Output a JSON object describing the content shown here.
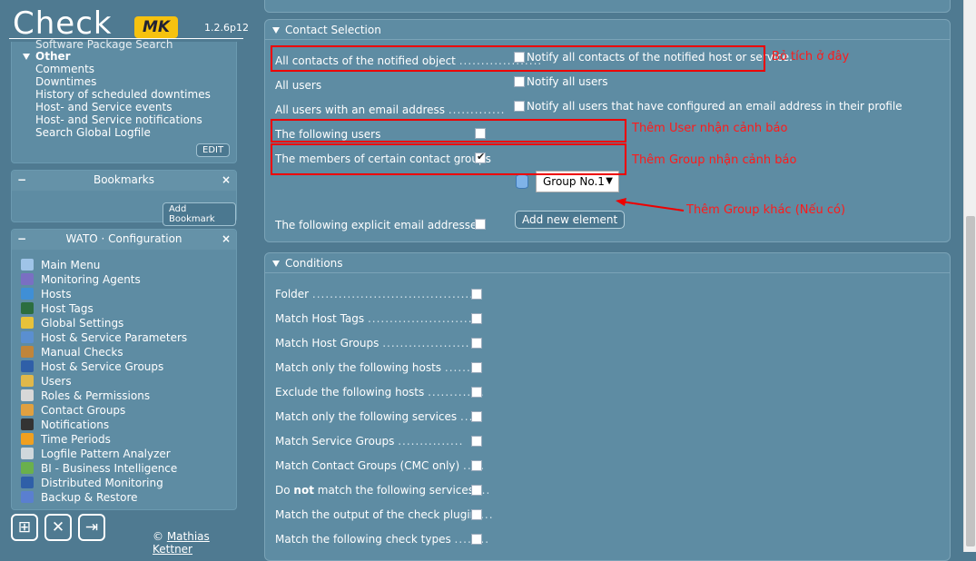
{
  "logo": {
    "text": "Check",
    "mk": "MK",
    "version": "1.2.6p12"
  },
  "views": {
    "cut_item": "Software Package Search",
    "group": "Other",
    "items": [
      "Comments",
      "Downtimes",
      "History of scheduled downtimes",
      "Host- and Service events",
      "Host- and Service notifications",
      "Search Global Logfile"
    ],
    "edit_label": "EDIT"
  },
  "bookmarks": {
    "title": "Bookmarks",
    "add_label": "Add Bookmark"
  },
  "wato": {
    "title": "WATO · Configuration",
    "items": [
      {
        "label": "Main Menu",
        "icon": "home-icon",
        "color": "#9fc4e8"
      },
      {
        "label": "Monitoring Agents",
        "icon": "agent-icon",
        "color": "#7a6fc2"
      },
      {
        "label": "Hosts",
        "icon": "hosts-icon",
        "color": "#3f8fd6"
      },
      {
        "label": "Host Tags",
        "icon": "tag-icon",
        "color": "#2c6e3f"
      },
      {
        "label": "Global Settings",
        "icon": "settings-icon",
        "color": "#e8c23a"
      },
      {
        "label": "Host & Service Parameters",
        "icon": "rulesets-icon",
        "color": "#5a8fd0"
      },
      {
        "label": "Manual Checks",
        "icon": "manual-checks-icon",
        "color": "#c0853a"
      },
      {
        "label": "Host & Service Groups",
        "icon": "groups-icon",
        "color": "#2f5fa8"
      },
      {
        "label": "Users",
        "icon": "users-icon",
        "color": "#e0b84a"
      },
      {
        "label": "Roles & Permissions",
        "icon": "roles-icon",
        "color": "#d8d8d8"
      },
      {
        "label": "Contact Groups",
        "icon": "contact-groups-icon",
        "color": "#e0a040"
      },
      {
        "label": "Notifications",
        "icon": "notifications-icon",
        "color": "#333333"
      },
      {
        "label": "Time Periods",
        "icon": "timeperiods-icon",
        "color": "#f0a020"
      },
      {
        "label": "Logfile Pattern Analyzer",
        "icon": "logfile-icon",
        "color": "#cfd8dc"
      },
      {
        "label": "BI - Business Intelligence",
        "icon": "bi-icon",
        "color": "#6ab04c"
      },
      {
        "label": "Distributed Monitoring",
        "icon": "sites-icon",
        "color": "#2f5fa8"
      },
      {
        "label": "Backup & Restore",
        "icon": "backup-icon",
        "color": "#5a7fd0"
      }
    ]
  },
  "footer": {
    "copyright_symbol": "©",
    "author": "Mathias Kettner"
  },
  "contact_selection": {
    "title": "Contact Selection",
    "rows": [
      {
        "label": "All contacts of the notified object",
        "dots": "...................",
        "desc": "Notify all contacts of the notified host or service.",
        "checked": false
      },
      {
        "label": "All users",
        "dots": "",
        "desc": "Notify all users",
        "checked": false
      },
      {
        "label": "All users with an email address",
        "dots": ".............",
        "desc": "Notify all users that have configured an email address in their profile",
        "checked": false
      },
      {
        "label": "The following users",
        "dots": "",
        "desc": "",
        "checked": false
      },
      {
        "label": "The members of certain contact groups",
        "dots": "",
        "desc": "",
        "checked": true
      },
      {
        "label": "The following explicit email addresses",
        "dots": "",
        "desc": "",
        "checked": false
      }
    ],
    "group_select": "Group No.1",
    "add_button": "Add new element"
  },
  "annotations": {
    "a1": "Bỏ tích ở đây",
    "a2": "Thêm User nhận cảnh báo",
    "a3": "Thêm Group nhận cảnh báo",
    "a4": "Thêm Group khác (Nếu có)"
  },
  "conditions": {
    "title": "Conditions",
    "rows": [
      {
        "label": "Folder",
        "dots": "....................................."
      },
      {
        "label": "Match Host Tags",
        "dots": "........................"
      },
      {
        "label": "Match Host Groups",
        "dots": "...................."
      },
      {
        "label": "Match only the following hosts",
        "dots": "......."
      },
      {
        "label": "Exclude the following hosts",
        "dots": "............."
      },
      {
        "label": "Match only the following services",
        "dots": "...."
      },
      {
        "label": "Match Service Groups",
        "dots": "..............."
      },
      {
        "label": "Match Contact Groups (CMC only)",
        "dots": "....."
      },
      {
        "label_pre": "Do ",
        "label_bold": "not",
        "label_post": " match the following services",
        "dots": "..."
      },
      {
        "label": "Match the output of the check plugin",
        "dots": "..."
      },
      {
        "label": "Match the following check types",
        "dots": "........"
      }
    ]
  }
}
